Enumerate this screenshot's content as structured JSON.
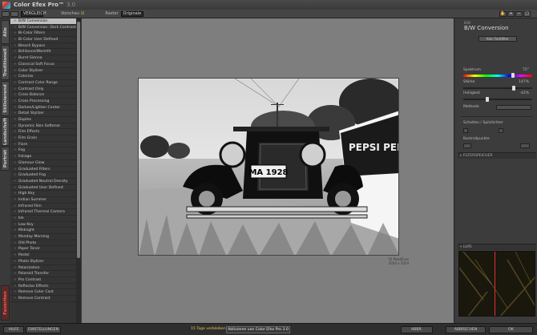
{
  "app": {
    "title": "Color Efex Pro™",
    "version": "3.0"
  },
  "toolbar": {
    "view_label": "Vorschau",
    "view_select": "VERGLEICH",
    "mode_label": "Raster",
    "mode_select": "Originale",
    "bg_label": "Hintergrund",
    "zoom_value": "",
    "icons": [
      "hand-icon",
      "zoom-in-icon",
      "zoom-out-icon",
      "fit-icon"
    ]
  },
  "left_tabs": [
    {
      "label": "Alle",
      "name": "tab-all"
    },
    {
      "label": "Traditionell",
      "name": "tab-traditional"
    },
    {
      "label": "Stilisierend",
      "name": "tab-stylizing"
    },
    {
      "label": "Landschaft",
      "name": "tab-landscape"
    },
    {
      "label": "Porträt",
      "name": "tab-portrait"
    },
    {
      "label": "Favoriten",
      "name": "tab-favorites"
    }
  ],
  "filters": [
    "B/W Conversion",
    "B/W Conversion: Dark Contrasts",
    "Bi-Color Filters",
    "Bi-Color User Defined",
    "Bleach Bypass",
    "Brilliance/Warmth",
    "Burnt Sienna",
    "Classical Soft Focus",
    "Color Stylizer",
    "Colorize",
    "Contrast Color Range",
    "Contrast Only",
    "Cross Balance",
    "Cross Processing",
    "Darken/Lighten Center",
    "Detail Stylizer",
    "Duplex",
    "Dynamic Skin Softener",
    "Film Effects",
    "Film Grain",
    "Flare",
    "Fog",
    "Foliage",
    "Glamour Glow",
    "Graduated Filters",
    "Graduated Fog",
    "Graduated Neutral Density",
    "Graduated User Defined",
    "High Key",
    "Indian Summer",
    "Infrared Film",
    "Infrared Thermal Camera",
    "Ink",
    "Low Key",
    "Midnight",
    "Monday Morning",
    "Old Photo",
    "Paper Toner",
    "Pastel",
    "Photo Stylizer",
    "Polarization",
    "Polaroid Transfer",
    "Pro Contrast",
    "Reflector Effects",
    "Remove Color Cast",
    "Remove Contrast"
  ],
  "active_filter_index": 0,
  "list_scroll": {
    "thumb_fraction": 0.78
  },
  "photo": {
    "plate_text": "MA 1928",
    "sign_text": "PEPSI PEPSI",
    "caption_line1": "72 Pixel/Fuss",
    "caption_line2": "1024 x 1024"
  },
  "right_panel": {
    "small_title": "B/W",
    "title": "B/W Conversion",
    "preset": "Kein Farbfilter",
    "spectrum_label": "Spektrum",
    "spectrum_value": "72°",
    "spectrum_position": 0.72,
    "strength_label": "Stärke",
    "strength_value": "147%",
    "strength_position": 0.73,
    "brightness_label": "Helligkeit",
    "brightness_value": "-42%",
    "brightness_position": 0.35,
    "method_label": "Methode",
    "shadows_label": "Schatten / Spitzlichter",
    "control_points_label": "Kontrollpunkte",
    "section_filter_memory": "FILTERSPEICHER",
    "section_loupe": "LUPE"
  },
  "bottom": {
    "help": "HILFE",
    "settings": "EINSTELLUNGEN",
    "trial": "15 Tage verbleibend",
    "buy": "Aktivieren von Color Efex Pro 3.0",
    "cancel": "ABBR.",
    "apply": "ABBRECHEN",
    "ok": "OK"
  },
  "colors": {
    "accent": "#e8c84a",
    "favorite": "#f06050",
    "loupe_line": "#e03030"
  }
}
